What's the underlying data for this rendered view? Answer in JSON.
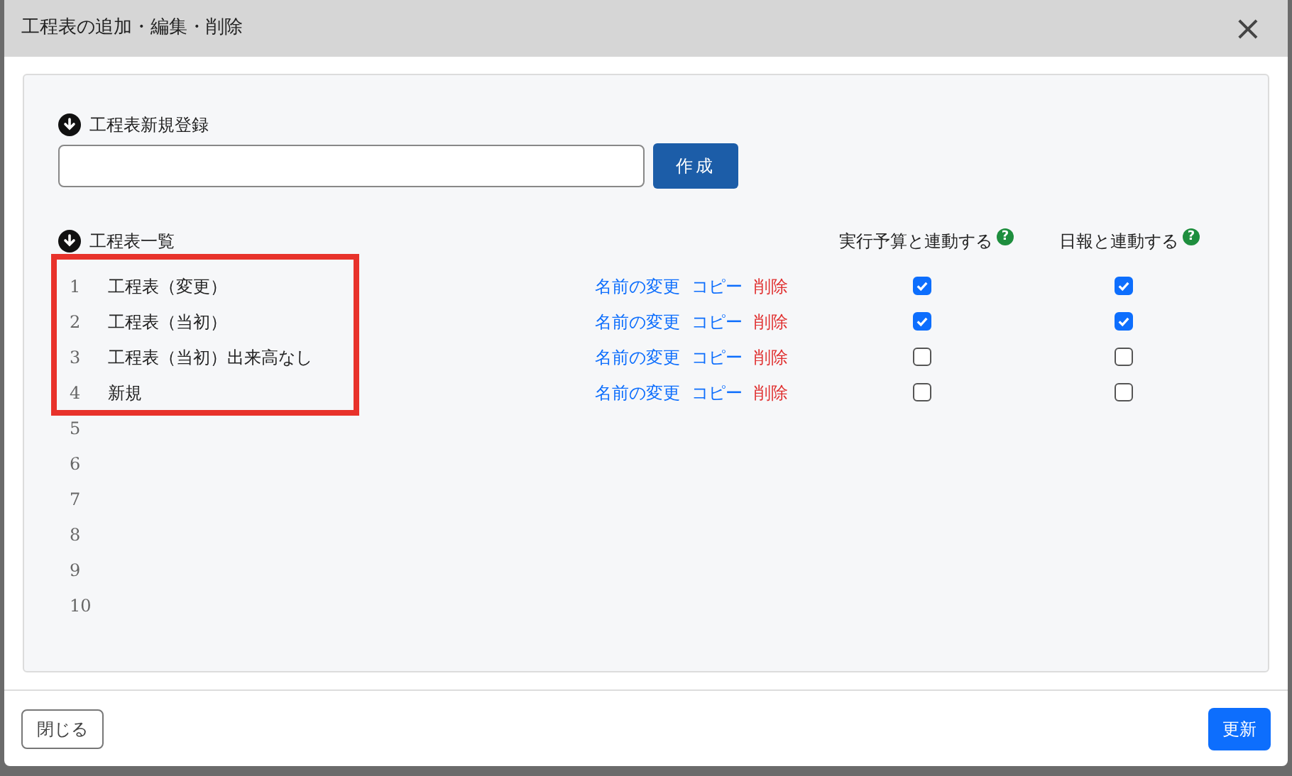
{
  "dialog": {
    "title": "工程表の追加・編集・削除",
    "close_icon": "×"
  },
  "new_section": {
    "heading": "工程表新規登録",
    "create_button": "作成"
  },
  "list_section": {
    "heading": "工程表一覧",
    "columns": [
      {
        "label": "実行予算と連動する",
        "help_mark": "?"
      },
      {
        "label": "日報と連動する",
        "help_mark": "?"
      }
    ],
    "rows": [
      {
        "number": "1",
        "name": "工程表（変更）",
        "actions": [
          "名前の変更",
          "コピー",
          "削除"
        ],
        "budget_linked": true,
        "report_linked": true
      },
      {
        "number": "2",
        "name": "工程表（当初）",
        "actions": [
          "名前の変更",
          "コピー",
          "削除"
        ],
        "budget_linked": true,
        "report_linked": true
      },
      {
        "number": "3",
        "name": "工程表（当初）出来高なし",
        "actions": [
          "名前の変更",
          "コピー",
          "削除"
        ],
        "budget_linked": false,
        "report_linked": false
      },
      {
        "number": "4",
        "name": "新規",
        "actions": [
          "名前の変更",
          "コピー",
          "削除"
        ],
        "budget_linked": false,
        "report_linked": false
      },
      {
        "number": "5"
      },
      {
        "number": "6"
      },
      {
        "number": "7"
      },
      {
        "number": "8"
      },
      {
        "number": "9"
      },
      {
        "number": "10"
      }
    ]
  },
  "footer": {
    "close_button": "閉じる",
    "update_button": "更新"
  }
}
